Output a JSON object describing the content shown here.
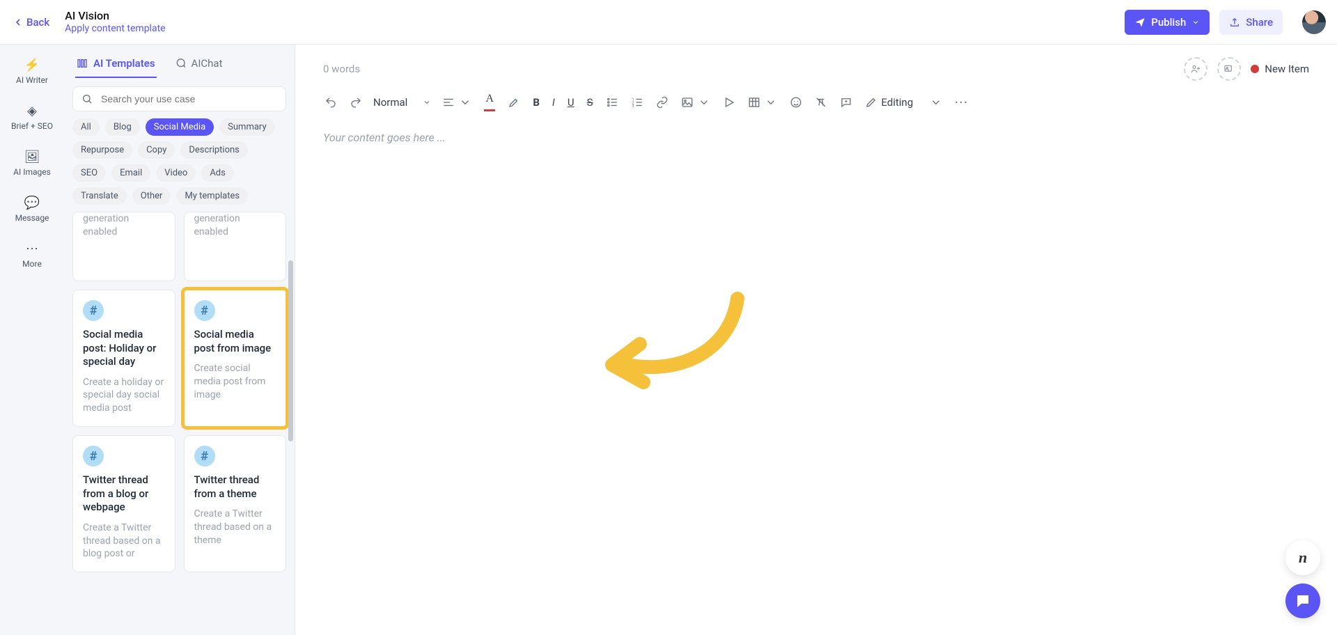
{
  "header": {
    "back_label": "Back",
    "title": "AI Vision",
    "apply_template": "Apply content template",
    "publish_label": "Publish",
    "share_label": "Share"
  },
  "rail": {
    "items": [
      {
        "label": "AI Writer",
        "icon": "⚡"
      },
      {
        "label": "Brief + SEO",
        "icon": "◈"
      },
      {
        "label": "AI Images",
        "icon": "🖼"
      },
      {
        "label": "Message",
        "icon": "💬"
      },
      {
        "label": "More",
        "icon": "⋯"
      }
    ]
  },
  "panel": {
    "tabs": {
      "templates": "AI Templates",
      "chat": "AIChat"
    },
    "search_placeholder": "Search your use case",
    "filters": [
      "All",
      "Blog",
      "Social Media",
      "Summary",
      "Repurpose",
      "Copy",
      "Descriptions",
      "SEO",
      "Email",
      "Video",
      "Ads",
      "Translate",
      "Other",
      "My templates"
    ],
    "active_filter": "Social Media",
    "cards": [
      {
        "partial": true,
        "title": "",
        "desc": "generation enabled"
      },
      {
        "partial": true,
        "title": "",
        "desc": "generation enabled"
      },
      {
        "title": "Social media post: Holiday or special day",
        "desc": "Create a holiday or special day social media post"
      },
      {
        "title": "Social media post from image",
        "desc": "Create social media post from image",
        "highlight": true
      },
      {
        "title": "Twitter thread from a blog or webpage",
        "desc": "Create a Twitter thread based on a blog post or"
      },
      {
        "title": "Twitter thread from a theme",
        "desc": "Create a Twitter thread based on a theme"
      }
    ]
  },
  "editor": {
    "word_count": "0 words",
    "new_item_label": "New Item",
    "style_label": "Normal",
    "mode_label": "Editing",
    "placeholder": "Your content goes here ..."
  },
  "annotation": {
    "highlight_color": "#f5c13b"
  }
}
